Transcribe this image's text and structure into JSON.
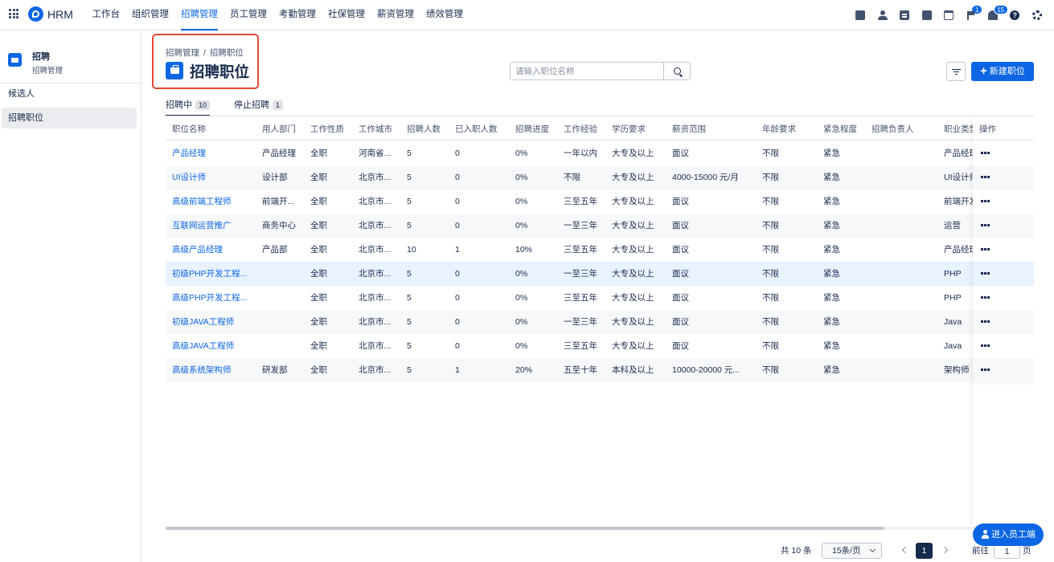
{
  "app": {
    "brand": "HRM"
  },
  "nav": [
    "工作台",
    "组织管理",
    "招聘管理",
    "员工管理",
    "考勤管理",
    "社保管理",
    "薪资管理",
    "绩效管理"
  ],
  "nav_active_index": 2,
  "top_icons": {
    "flag_badge": "1",
    "bell_badge": "15",
    "help_glyph": "?"
  },
  "sidebar": {
    "title": "招聘",
    "subtitle": "招聘管理",
    "items": [
      {
        "label": "候选人",
        "active": false
      },
      {
        "label": "招聘职位",
        "active": true
      }
    ]
  },
  "breadcrumb": {
    "items": [
      "招聘管理",
      "招聘职位"
    ],
    "separator": "/"
  },
  "page_title": "招聘职位",
  "search": {
    "placeholder": "请输入职位名称",
    "value": ""
  },
  "new_button": {
    "label": "新建职位"
  },
  "tabs": [
    {
      "label": "招聘中",
      "count": "10",
      "active": true
    },
    {
      "label": "停止招聘",
      "count": "1",
      "active": false
    }
  ],
  "table": {
    "columns": [
      "职位名称",
      "用人部门",
      "工作性质",
      "工作城市",
      "招聘人数",
      "已入职人数",
      "招聘进度",
      "工作经验",
      "学历要求",
      "薪资范围",
      "年龄要求",
      "紧急程度",
      "招聘负责人",
      "职业类型"
    ],
    "action_column": "操作",
    "rows": [
      [
        "产品经理",
        "产品经理",
        "全职",
        "河南省...",
        "5",
        "0",
        "0%",
        "一年以内",
        "大专及以上",
        "面议",
        "不限",
        "紧急",
        "",
        "产品经理"
      ],
      [
        "UI设计师",
        "设计部",
        "全职",
        "北京市...",
        "5",
        "0",
        "0%",
        "不限",
        "大专及以上",
        "4000-15000 元/月",
        "不限",
        "紧急",
        "",
        "UI设计师"
      ],
      [
        "高级前端工程师",
        "前端开...",
        "全职",
        "北京市...",
        "5",
        "0",
        "0%",
        "三至五年",
        "大专及以上",
        "面议",
        "不限",
        "紧急",
        "",
        "前端开发"
      ],
      [
        "互联网运营推广",
        "商务中心",
        "全职",
        "北京市...",
        "5",
        "0",
        "0%",
        "一至三年",
        "大专及以上",
        "面议",
        "不限",
        "紧急",
        "",
        "运营"
      ],
      [
        "高级产品经理",
        "产品部",
        "全职",
        "北京市...",
        "10",
        "1",
        "10%",
        "三至五年",
        "大专及以上",
        "面议",
        "不限",
        "紧急",
        "",
        "产品经理"
      ],
      [
        "初级PHP开发工程...",
        "",
        "全职",
        "北京市...",
        "5",
        "0",
        "0%",
        "一至三年",
        "大专及以上",
        "面议",
        "不限",
        "紧急",
        "",
        "PHP"
      ],
      [
        "高级PHP开发工程...",
        "",
        "全职",
        "北京市...",
        "5",
        "0",
        "0%",
        "三至五年",
        "大专及以上",
        "面议",
        "不限",
        "紧急",
        "",
        "PHP"
      ],
      [
        "初级JAVA工程师",
        "",
        "全职",
        "北京市...",
        "5",
        "0",
        "0%",
        "一至三年",
        "大专及以上",
        "面议",
        "不限",
        "紧急",
        "",
        "Java"
      ],
      [
        "高级JAVA工程师",
        "",
        "全职",
        "北京市...",
        "5",
        "0",
        "0%",
        "三至五年",
        "大专及以上",
        "面议",
        "不限",
        "紧急",
        "",
        "Java"
      ],
      [
        "高级系统架构师",
        "研发部",
        "全职",
        "北京市...",
        "5",
        "1",
        "20%",
        "五至十年",
        "本科及以上",
        "10000-20000 元...",
        "不限",
        "紧急",
        "",
        "架构师"
      ]
    ],
    "selected_row_index": 5
  },
  "pagination": {
    "total_text": "共 10 条",
    "page_size": "15条/页",
    "current_page": "1",
    "goto_prefix": "前往",
    "goto_value": "1",
    "goto_suffix": "页"
  },
  "employee_portal_button": {
    "label": "进入员工端"
  },
  "colors": {
    "accent": "#0c66e4",
    "highlight_box": "#e34935",
    "selected_row": "#e9f2ff"
  }
}
